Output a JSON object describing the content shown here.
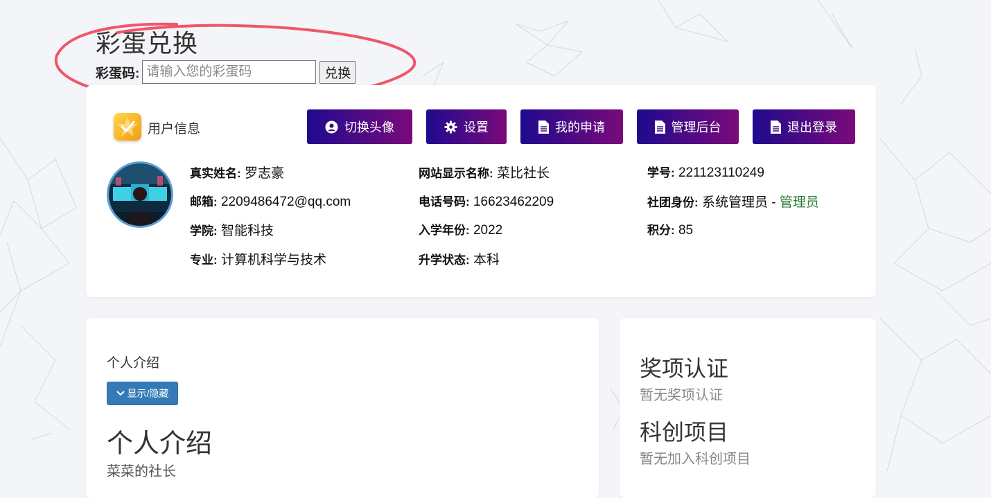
{
  "egg": {
    "title": "彩蛋兑换",
    "code_label": "彩蛋码:",
    "input_placeholder": "请输入您的彩蛋码",
    "input_value": "",
    "redeem_label": "兑换"
  },
  "user_card": {
    "header_label": "用户信息",
    "buttons": [
      {
        "label": "切换头像",
        "icon": "user-circle-icon"
      },
      {
        "label": "设置",
        "icon": "gear-icon"
      },
      {
        "label": "我的申请",
        "icon": "file-icon"
      },
      {
        "label": "管理后台",
        "icon": "file-icon"
      },
      {
        "label": "退出登录",
        "icon": "file-icon"
      }
    ],
    "fields": {
      "real_name": {
        "key": "真实姓名:",
        "value": " 罗志豪"
      },
      "email": {
        "key": "邮箱:",
        "value": " 2209486472@qq.com"
      },
      "college": {
        "key": "学院:",
        "value": " 智能科技"
      },
      "major": {
        "key": "专业:",
        "value": " 计算机科学与技术"
      },
      "display_name": {
        "key": "网站显示名称:",
        "value": " 菜比社长"
      },
      "phone": {
        "key": "电话号码:",
        "value": " 16623462209"
      },
      "enroll_year": {
        "key": "入学年份:",
        "value": " 2022"
      },
      "study_status": {
        "key": "升学状态:",
        "value": " 本科"
      },
      "student_id": {
        "key": "学号:",
        "value": " 221123110249"
      },
      "club_role": {
        "key": "社团身份:",
        "value": " 系统管理员",
        "sep": " - ",
        "role": "管理员"
      },
      "points": {
        "key": "积分:",
        "value": " 85"
      }
    }
  },
  "intro": {
    "section_label": "个人介绍",
    "toggle_label": "显示/隐藏",
    "heading": "个人介绍",
    "text": "菜菜的社长"
  },
  "awards": {
    "award_heading": "奖项认证",
    "award_empty": "暂无奖项认证",
    "project_heading": "科创项目",
    "project_empty": "暂无加入科创项目"
  },
  "colors": {
    "button_gradient_start": "#1f0a8e",
    "button_gradient_end": "#7a0a7a",
    "highlight_circle": "#f0566a",
    "role_green": "#2e7d32",
    "toggle_blue": "#337ab7"
  }
}
